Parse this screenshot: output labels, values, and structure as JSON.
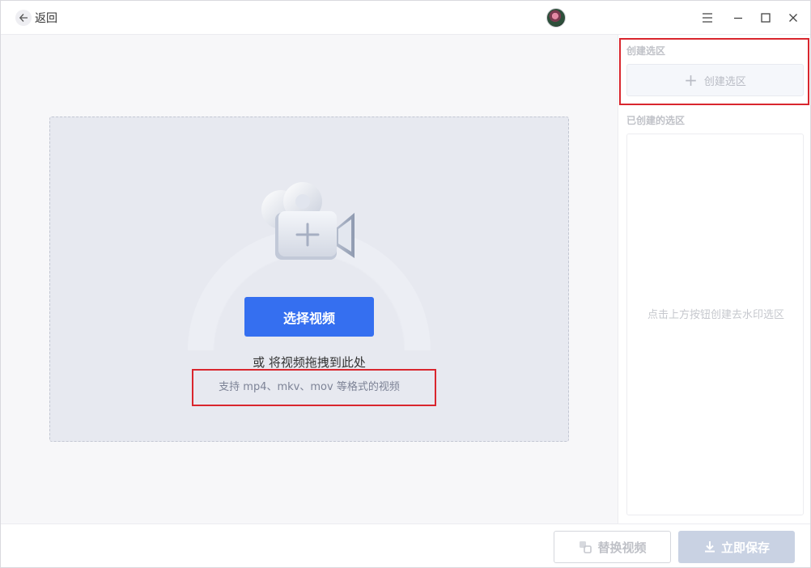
{
  "titlebar": {
    "back_label": "返回"
  },
  "icons": {
    "back": "arrow-left-icon",
    "avatar": "avatar",
    "menu": "hamburger-menu-icon",
    "minimize": "minimize-icon",
    "maximize": "maximize-icon",
    "close": "close-icon",
    "camera": "video-camera-plus-icon",
    "plus": "plus-icon",
    "replace": "replace-video-icon",
    "download": "download-icon"
  },
  "main": {
    "select_button": "选择视频",
    "drag_hint": "或 将视频拖拽到此处",
    "format_hint": "支持 mp4、mkv、mov 等格式的视频"
  },
  "sidebar": {
    "create_title": "创建选区",
    "create_button": "创建选区",
    "created_title": "已创建的选区",
    "empty_hint": "点击上方按钮创建去水印选区"
  },
  "footer": {
    "replace_button": "替换视频",
    "save_button": "立即保存"
  },
  "colors": {
    "accent": "#356ff0",
    "annotation_red": "#d9262e",
    "dropzone_bg": "#e7e9f0",
    "save_disabled": "#c9d2e3"
  }
}
